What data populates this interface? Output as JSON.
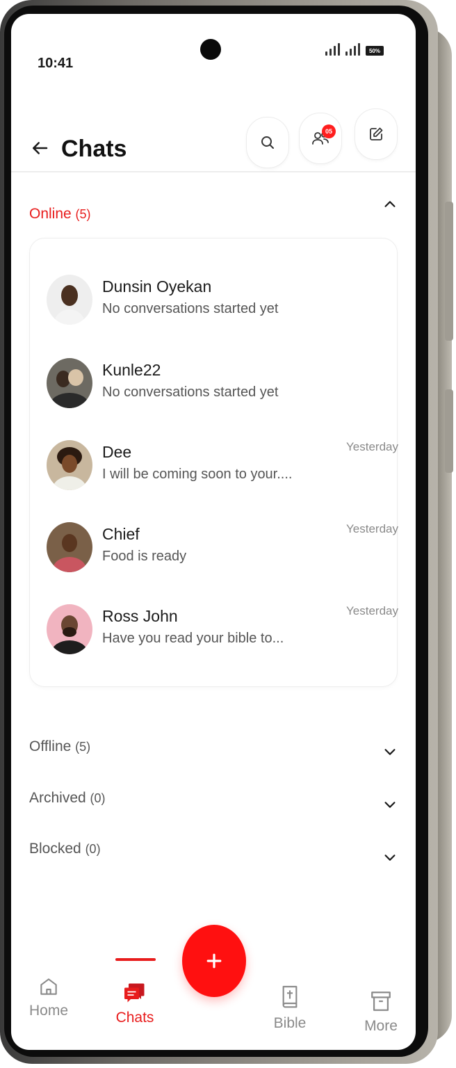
{
  "status_bar": {
    "time": "10:41",
    "battery": "50%"
  },
  "header": {
    "title": "Chats",
    "groups_badge": "05"
  },
  "online": {
    "label": "Online",
    "count": "(5)",
    "chats": [
      {
        "name": "Dunsin Oyekan",
        "message": "No conversations started yet",
        "time": ""
      },
      {
        "name": "Kunle22",
        "message": "No conversations started yet",
        "time": ""
      },
      {
        "name": "Dee",
        "message": "I will be coming soon to your....",
        "time": "Yesterday"
      },
      {
        "name": "Chief",
        "message": "Food is ready",
        "time": "Yesterday"
      },
      {
        "name": "Ross John",
        "message": "Have you read your bible to...",
        "time": "Yesterday"
      }
    ]
  },
  "sections": [
    {
      "label": "Offline",
      "count": "(5)"
    },
    {
      "label": "Archived",
      "count": "(0)"
    },
    {
      "label": "Blocked",
      "count": "(0)"
    }
  ],
  "nav": {
    "home": "Home",
    "chats": "Chats",
    "bible": "Bible",
    "more": "More"
  },
  "colors": {
    "accent": "#e81c1c",
    "fab": "#ff1010"
  },
  "icons": {
    "back": "arrow-left-icon",
    "search": "search-icon",
    "groups": "users-icon",
    "compose": "edit-icon",
    "fab": "plus-icon"
  }
}
